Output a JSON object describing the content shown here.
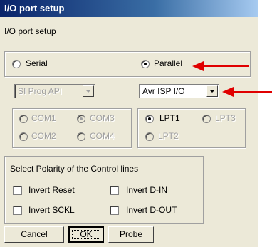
{
  "window": {
    "title": "I/O port setup"
  },
  "header": {
    "label": "I/O port setup"
  },
  "interface": {
    "serial_label": "Serial",
    "parallel_label": "Parallel",
    "selected": "Parallel"
  },
  "serial_api": {
    "value": "SI Prog API",
    "enabled": false
  },
  "parallel_api": {
    "value": "Avr ISP I/O",
    "enabled": true
  },
  "com_ports": {
    "options": [
      "COM1",
      "COM3",
      "COM2",
      "COM4"
    ],
    "selected": "COM3",
    "enabled": false
  },
  "lpt_ports": {
    "options": [
      "LPT1",
      "LPT3",
      "LPT2"
    ],
    "selected": "LPT1"
  },
  "polarity": {
    "title": "Select Polarity of the Control lines",
    "invert_reset": "Invert Reset",
    "invert_din": "Invert D-IN",
    "invert_sckl": "Invert SCKL",
    "invert_dout": "Invert D-OUT"
  },
  "buttons": {
    "cancel": "Cancel",
    "ok": "OK",
    "probe": "Probe"
  },
  "colors": {
    "annotation_arrow": "#e00000",
    "title_bar": "#0a246a"
  },
  "icons": [
    "dropdown-arrow-icon",
    "annotation-arrow-icon"
  ]
}
